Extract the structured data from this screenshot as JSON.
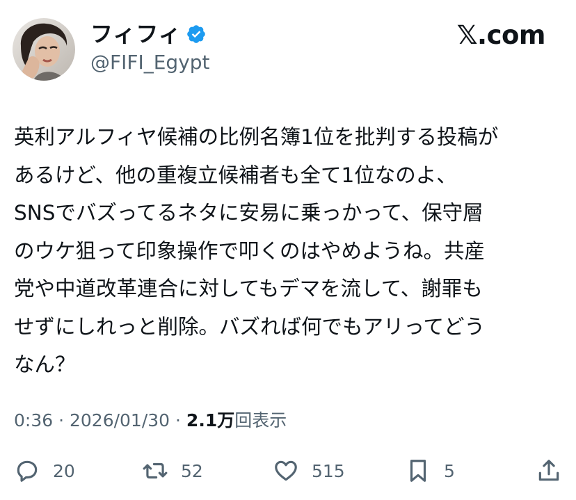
{
  "author": {
    "display_name": "フィフィ",
    "handle": "@FIFI_Egypt",
    "verified": true,
    "verified_color": "#1d9bf0"
  },
  "brand": {
    "label": "𝕏.com"
  },
  "post": {
    "lines": [
      "英利アルフィヤ候補の比例名簿1位を批判する投稿が",
      "あるけど、他の重複立候補者も全て1位なのよ、",
      "SNSでバズってるネタに安易に乗っかって、保守層",
      "のウケ狙って印象操作で叩くのはやめようね。共産",
      "党や中道改革連合に対してもデマを流して、謝罪も",
      "せずにしれっと削除。バズれば何でもアリってどう",
      "なん？"
    ]
  },
  "meta": {
    "time": "0:36",
    "separator": " · ",
    "date": "2026/01/30",
    "views_count": "2.1万",
    "views_label": "回表示"
  },
  "actions": {
    "reply_icon": "reply-icon",
    "reply_count": "20",
    "repost_icon": "repost-icon",
    "repost_count": "52",
    "like_icon": "heart-icon",
    "like_count": "515",
    "bookmark_icon": "bookmark-icon",
    "bookmark_count": "5",
    "share_icon": "share-icon"
  },
  "colors": {
    "text_primary": "#0f1419",
    "text_secondary": "#536471",
    "background": "#ffffff"
  }
}
